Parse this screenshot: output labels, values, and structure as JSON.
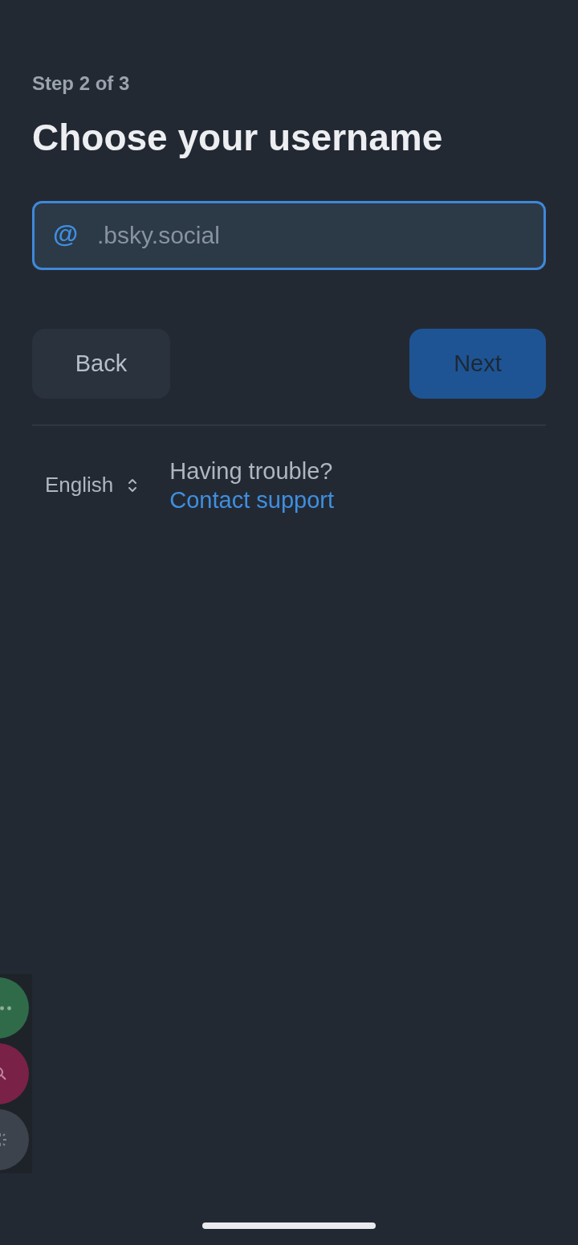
{
  "step": "Step 2 of 3",
  "title": "Choose your username",
  "handle_field": {
    "prefix": "@",
    "placeholder": ".bsky.social",
    "focused": true
  },
  "buttons": [
    {
      "label": "Back",
      "kind": "secondary",
      "disabled": false
    },
    {
      "label": "Next",
      "kind": "primary",
      "disabled": true
    }
  ],
  "language_select": {
    "value": "English"
  },
  "help": {
    "text": "Having trouble?",
    "link": "Contact support"
  },
  "side_buttons": [
    {
      "kind": "more",
      "color": "#2f6b48"
    },
    {
      "kind": "search",
      "color": "#7a2148"
    },
    {
      "kind": "sparkle",
      "color": "#3c434c"
    }
  ]
}
